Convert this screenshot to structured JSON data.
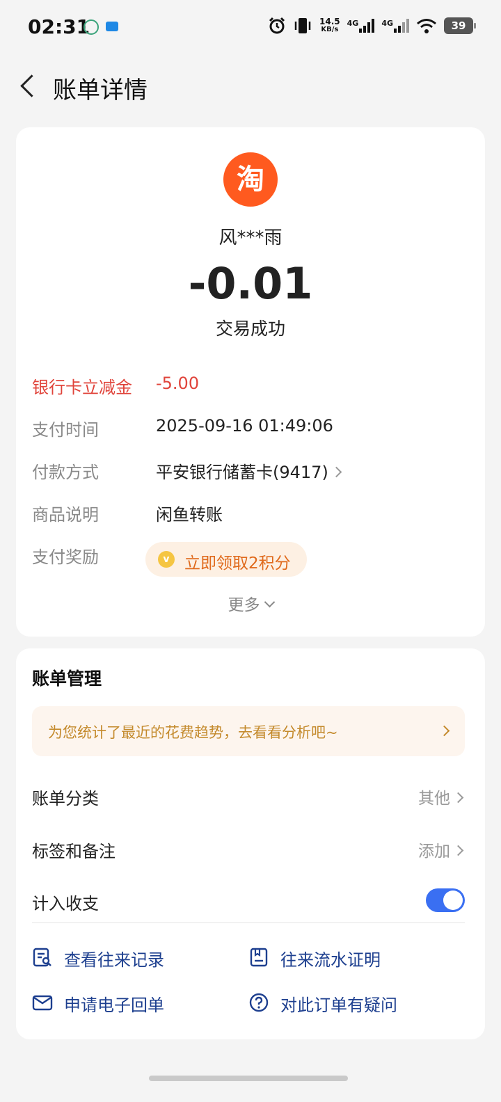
{
  "status_bar": {
    "time": "02:31",
    "net_speed_value": "14.5",
    "net_speed_unit": "KB/s",
    "signal1_label": "4G",
    "signal2_label": "4G",
    "battery": "39"
  },
  "header": {
    "title": "账单详情"
  },
  "transaction": {
    "merchant_logo_char": "淘",
    "merchant_name": "风***雨",
    "amount": "-0.01",
    "status": "交易成功",
    "details": [
      {
        "label": "银行卡立减金",
        "value": "-5.00",
        "accent": "#e0443b"
      },
      {
        "label": "支付时间",
        "value": "2025-09-16 01:49:06"
      },
      {
        "label": "付款方式",
        "value": "平安银行储蓄卡(9417)"
      },
      {
        "label": "商品说明",
        "value": "闲鱼转账"
      },
      {
        "label": "支付奖励",
        "value": ""
      }
    ],
    "reward_button": "立即领取2积分",
    "more_label": "更多"
  },
  "bill_management": {
    "title": "账单管理",
    "banner_text": "为您统计了最近的花费趋势，去看看分析吧~",
    "rows": [
      {
        "label": "账单分类",
        "value": "其他"
      },
      {
        "label": "标签和备注",
        "value": "添加"
      },
      {
        "label": "计入收支",
        "toggle_on": true
      }
    ],
    "actions": [
      {
        "label": "查看往来记录",
        "icon": "record-search-icon"
      },
      {
        "label": "往来流水证明",
        "icon": "document-icon"
      },
      {
        "label": "申请电子回单",
        "icon": "mail-icon"
      },
      {
        "label": "对此订单有疑问",
        "icon": "question-icon"
      }
    ]
  },
  "colors": {
    "accent_blue": "#3a6ff2",
    "link_blue": "#1d3f8f",
    "discount_red": "#e0443b",
    "taobao_orange": "#ff5a1f",
    "banner_gold": "#c48a2c"
  }
}
